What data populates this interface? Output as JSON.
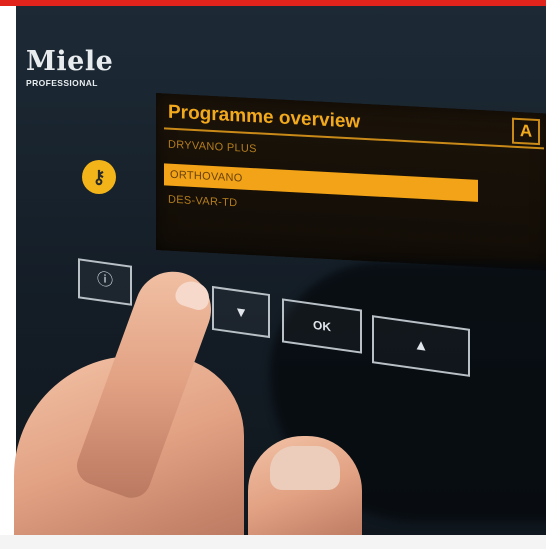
{
  "brand": {
    "name": "Miele",
    "sub": "PROFESSIONAL"
  },
  "display": {
    "title": "Programme overview",
    "badge": "A",
    "programmes": [
      "DRYVANO PLUS",
      "ORTHOVANO",
      "DES-VAR-TD"
    ],
    "selected_index": 1
  },
  "buttons": {
    "key_icon": "key-icon",
    "info_label": "ⓘ",
    "down_label": "▼",
    "ok_label": "OK",
    "up_label": "▲"
  },
  "colors": {
    "accent_amber": "#f2a317",
    "brand_red": "#e0241b",
    "key_yellow": "#f3b419"
  }
}
